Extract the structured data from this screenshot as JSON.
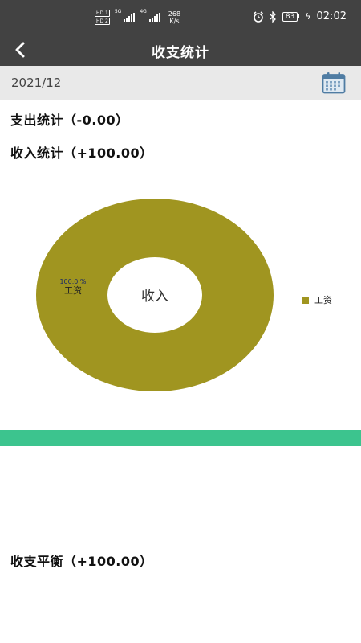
{
  "status_bar": {
    "hd1": "HD 1",
    "hd2": "HD 2",
    "net1": "5G",
    "net2": "4G",
    "speed_value": "268",
    "speed_unit": "K/s",
    "battery": "83",
    "time": "02:02",
    "icons": [
      "alarm-icon",
      "bluetooth-icon",
      "battery-icon",
      "charging-icon"
    ]
  },
  "header": {
    "title": "收支统计",
    "back_icon": "back-arrow-icon"
  },
  "date_bar": {
    "date": "2021/12",
    "calendar_icon": "calendar-icon"
  },
  "summaries": {
    "expense": "支出统计（-0.00）",
    "income": "收入统计（+100.00）",
    "balance": "收支平衡（+100.00）"
  },
  "chart_data": {
    "type": "pie",
    "center_label": "收入",
    "categories": [
      "工资"
    ],
    "values": [
      100.0
    ],
    "percent_labels": [
      "100.0 %"
    ],
    "colors": [
      "#a09520"
    ],
    "legend_position": "right"
  },
  "colors": {
    "bar_bg": "#424242",
    "date_bg": "#e9e9e9",
    "accent": "#3cc48e",
    "series": "#a09520"
  }
}
